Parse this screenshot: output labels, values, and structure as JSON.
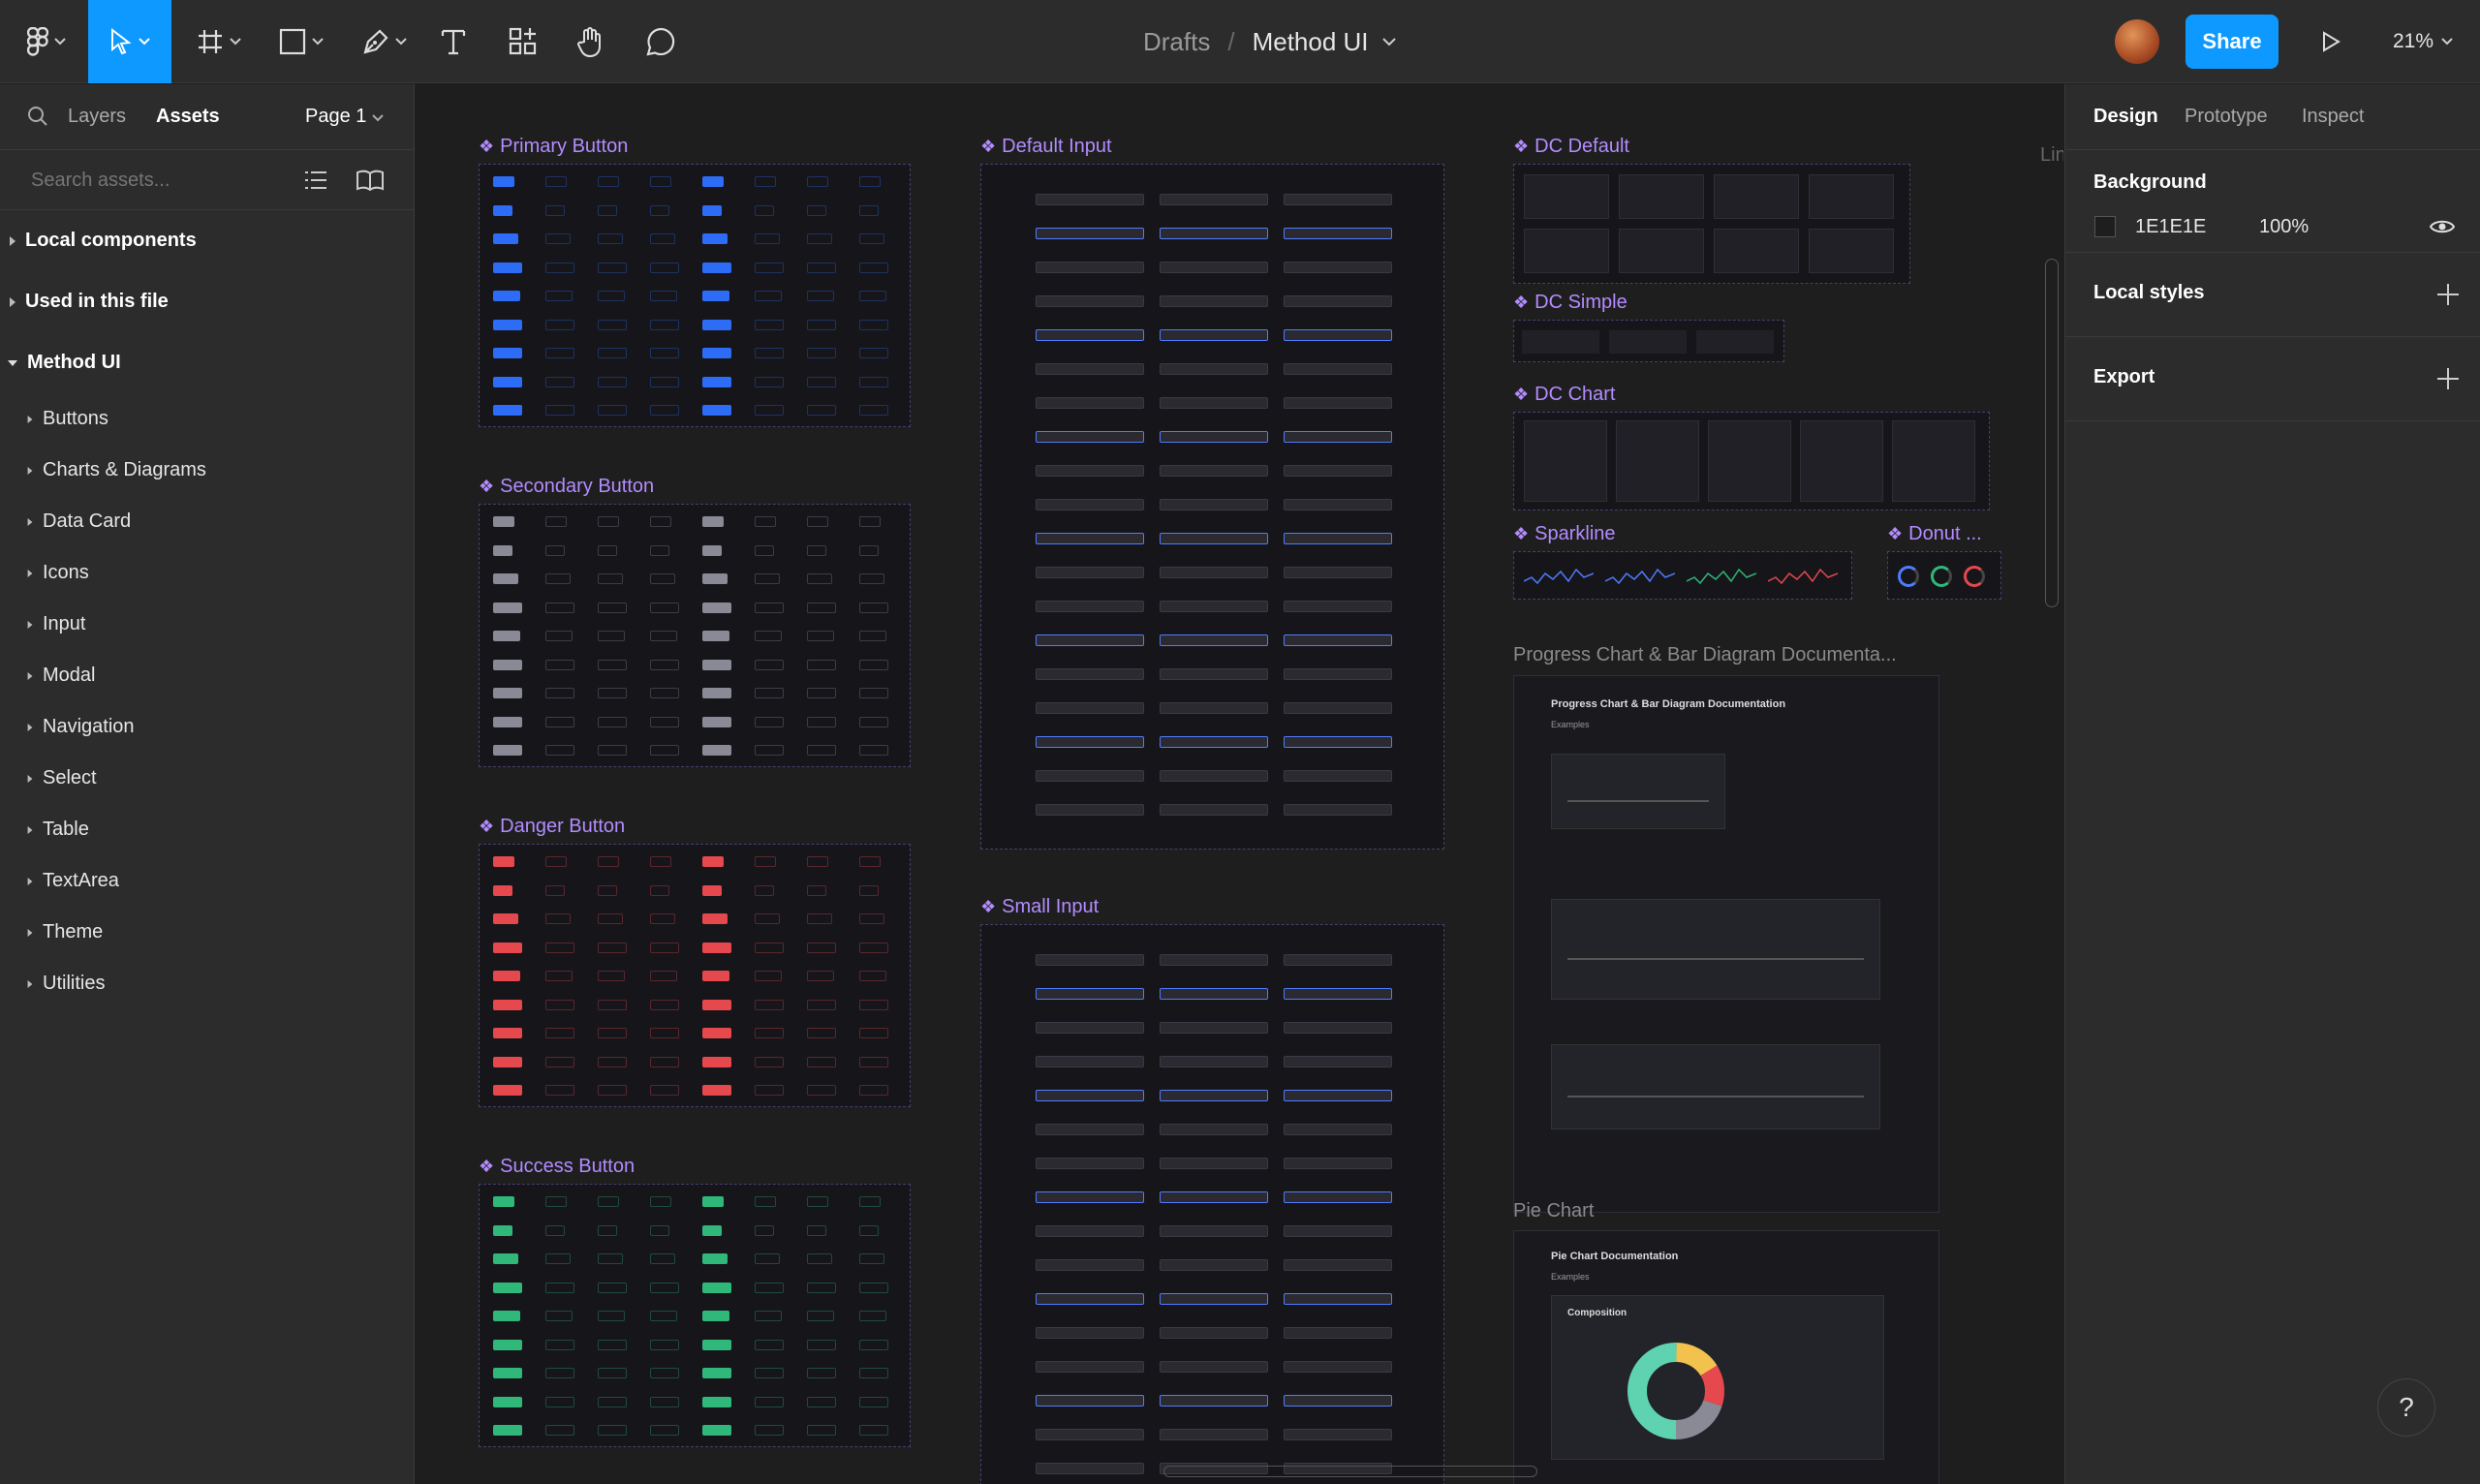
{
  "topbar": {
    "breadcrumb_drafts": "Drafts",
    "breadcrumb_sep": "/",
    "file_name": "Method UI",
    "share_label": "Share",
    "zoom_label": "21%"
  },
  "left_panel": {
    "tabs": {
      "layers": "Layers",
      "assets": "Assets"
    },
    "page": "Page 1",
    "search_placeholder": "Search assets...",
    "sections": {
      "local": "Local components",
      "used": "Used in this file",
      "library": "Method UI"
    },
    "items": [
      "Buttons",
      "Charts & Diagrams",
      "Data Card",
      "Icons",
      "Input",
      "Modal",
      "Navigation",
      "Select",
      "Table",
      "TextArea",
      "Theme",
      "Utilities"
    ]
  },
  "canvas": {
    "frames": {
      "primary": "Primary Button",
      "secondary": "Secondary Button",
      "danger": "Danger Button",
      "success": "Success Button",
      "default_input": "Default Input",
      "small_input": "Small Input",
      "dc_default": "DC Default",
      "dc_simple": "DC Simple",
      "dc_chart": "DC Chart",
      "sparkline": "Sparkline",
      "donut": "Donut ..."
    },
    "partial_label": "Lin",
    "progress_label": "Progress Chart & Bar Diagram Documenta...",
    "pie_label": "Pie Chart",
    "progress_doc_title": "Progress Chart & Bar Diagram Documentation",
    "pie_doc_title": "Pie Chart Documentation",
    "examples_label": "Examples",
    "composition_label": "Composition"
  },
  "right_panel": {
    "tabs": {
      "design": "Design",
      "prototype": "Prototype",
      "inspect": "Inspect"
    },
    "background_label": "Background",
    "bg_hex": "1E1E1E",
    "bg_opacity": "100%",
    "local_styles": "Local styles",
    "export": "Export"
  },
  "help": "?",
  "colors": {
    "accent": "#0d99ff",
    "component": "#b38cff",
    "primary": "#2d6cf6",
    "danger": "#e5484d",
    "success": "#2fb87a"
  },
  "icons": [
    "figma-menu-icon",
    "move-tool-icon",
    "frame-tool-icon",
    "shape-tool-icon",
    "pen-tool-icon",
    "text-tool-icon",
    "resources-icon",
    "hand-tool-icon",
    "comment-icon",
    "play-icon",
    "search-icon",
    "list-view-icon",
    "library-icon",
    "eye-icon",
    "help-icon"
  ]
}
